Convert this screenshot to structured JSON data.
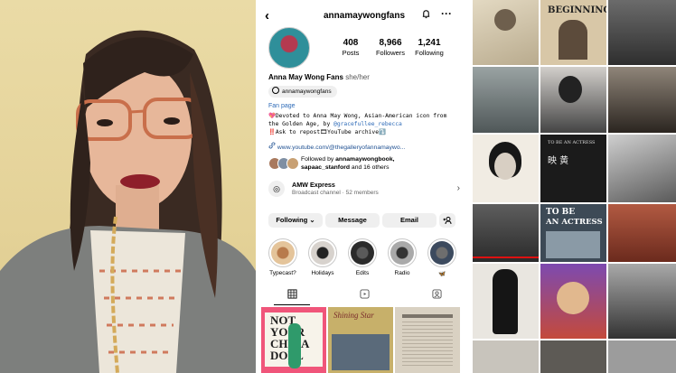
{
  "profile": {
    "username": "annamaywongfans",
    "stats": [
      {
        "num": "408",
        "label": "Posts"
      },
      {
        "num": "8,966",
        "label": "Followers"
      },
      {
        "num": "1,241",
        "label": "Following"
      }
    ],
    "display_name": "Anna May Wong Fans",
    "pronouns": "she/her",
    "threads_handle": "annamaywongfans",
    "category": "Fan page",
    "bio_line1": "💖Devoted to Anna May Wong, Asian-American icon from",
    "bio_line2_prefix": "the Golden Age, by ",
    "bio_mention": "@gracefullee_rebecca",
    "bio_line3": "‼️Ask to repost🎞YouTube archive⤵️",
    "link": "www.youtube.com/@thegalleryofannamaywo...",
    "followed_prefix": "Followed by ",
    "followed_names": "annamaywongbook,",
    "followed_names2": "sapaac_stanford",
    "followed_suffix": " and 16 others",
    "channel_title": "AMW Express",
    "channel_sub": "Broadcast channel · 52 members",
    "buttons": {
      "following": "Following ⌄",
      "message": "Message",
      "email": "Email",
      "add_person": "+⚲"
    },
    "highlights": [
      "Typecast?",
      "Holidays",
      "Edits",
      "Radio",
      ""
    ],
    "icons": {
      "back": "‹",
      "bell": "🔔",
      "more": "···",
      "grid": "▦",
      "reels": "▶",
      "tagged": "☺",
      "chevron": "›",
      "channel": "◎",
      "link": "🔗",
      "butterfly": "🦋"
    }
  },
  "posts": {
    "post1_title": "NOT YOUR CHINA DOLL",
    "post2_title": "Shining Star"
  },
  "grid": {
    "beginning": "BEGINNING",
    "actress_top": "TO BE",
    "actress_bottom": "AN ACTRESS",
    "actress_small": "TO BE AN ACTRESS"
  },
  "colors": {
    "link": "#2e6bb8",
    "chip_bg": "#efefef",
    "button_bg": "#efefef"
  }
}
